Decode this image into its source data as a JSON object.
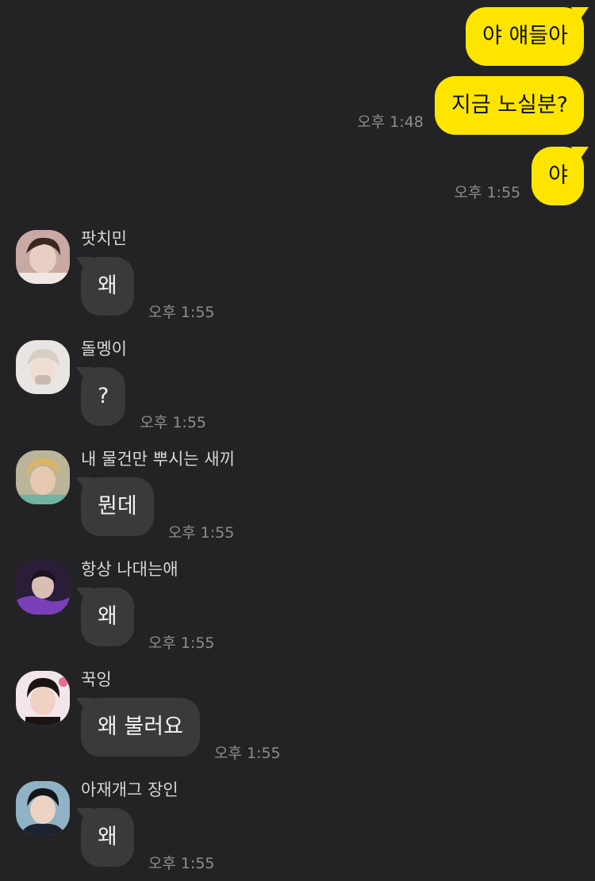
{
  "outgoing": [
    {
      "text": "야 얘들아",
      "time": ""
    },
    {
      "text": "지금 노실분?",
      "time": "오후 1:48"
    },
    {
      "text": "야",
      "time": "오후 1:55"
    }
  ],
  "incoming": [
    {
      "sender": "팟치민",
      "text": "왜",
      "time": "오후 1:55",
      "avatar": "profile-photo-1"
    },
    {
      "sender": "돌멩이",
      "text": "?",
      "time": "오후 1:55",
      "avatar": "profile-photo-2"
    },
    {
      "sender": "내 물건만 뿌시는 새끼",
      "text": "뭔데",
      "time": "오후 1:55",
      "avatar": "profile-photo-3"
    },
    {
      "sender": "항상 나대는애",
      "text": "왜",
      "time": "오후 1:55",
      "avatar": "profile-photo-4"
    },
    {
      "sender": "꾹잉",
      "text": "왜 불러요",
      "time": "오후 1:55",
      "avatar": "profile-photo-5"
    },
    {
      "sender": "아재개그 장인",
      "text": "왜",
      "time": "오후 1:55",
      "avatar": "profile-photo-6"
    }
  ],
  "colors": {
    "background": "#232325",
    "outgoing_bubble": "#fee500",
    "incoming_bubble": "#3a3a3c",
    "timestamp": "#8d8d90"
  }
}
